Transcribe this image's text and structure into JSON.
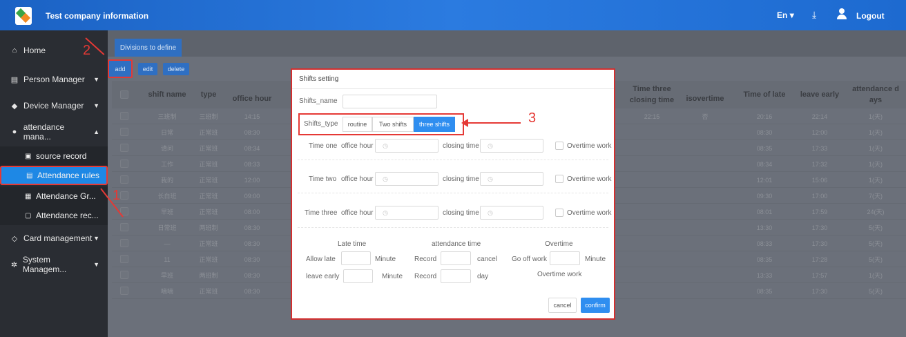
{
  "header": {
    "title": "Test company information",
    "language": "En",
    "logout": "Logout"
  },
  "sidebar": {
    "items": [
      {
        "label": "Home",
        "icon": "home-icon"
      },
      {
        "label": "Person Manager",
        "icon": "list-icon"
      },
      {
        "label": "Device Manager",
        "icon": "device-icon"
      },
      {
        "label": "attendance mana...",
        "icon": "clock-icon"
      },
      {
        "label": "Card management",
        "icon": "card-icon"
      },
      {
        "label": "System Managem...",
        "icon": "gear-icon"
      }
    ],
    "subitems": [
      {
        "label": "source record",
        "icon": "edit-icon"
      },
      {
        "label": "Attendance rules",
        "icon": "rules-icon"
      },
      {
        "label": "Attendance Gr...",
        "icon": "group-icon"
      },
      {
        "label": "Attendance rec...",
        "icon": "calendar-icon"
      }
    ]
  },
  "tabs": {
    "divisions": "Divisions to define"
  },
  "toolbar": {
    "add": "add",
    "edit": "edit",
    "delete": "delete"
  },
  "table": {
    "headers": {
      "shift_name": "shift name",
      "type": "type",
      "office_hour": "office hour",
      "time_three_closing": "Time three closing time",
      "isovertime": "isovertime",
      "time_of_late": "Time of late",
      "leave_early": "leave early",
      "attendance_days": "attendance d ays"
    },
    "rows": [
      {
        "name": "三班制",
        "type": "三班制",
        "hour": "14:15",
        "closing": "22:15",
        "overtime": "否",
        "late": "20:16",
        "early": "22:14",
        "days": "1(天)"
      },
      {
        "name": "日常",
        "type": "正常班",
        "hour": "08:30",
        "closing": "",
        "overtime": "",
        "late": "08:30",
        "early": "12:00",
        "days": "1(天)"
      },
      {
        "name": "请问",
        "type": "正常班",
        "hour": "08:34",
        "closing": "",
        "overtime": "",
        "late": "08:35",
        "early": "17:33",
        "days": "1(天)"
      },
      {
        "name": "工作",
        "type": "正常班",
        "hour": "08:33",
        "closing": "",
        "overtime": "",
        "late": "08:34",
        "early": "17:32",
        "days": "1(天)"
      },
      {
        "name": "我的",
        "type": "正常班",
        "hour": "12:00",
        "closing": "",
        "overtime": "",
        "late": "12:01",
        "early": "15:06",
        "days": "1(天)"
      },
      {
        "name": "长白班",
        "type": "正常班",
        "hour": "09:00",
        "closing": "",
        "overtime": "",
        "late": "09:30",
        "early": "17:00",
        "days": "7(天)"
      },
      {
        "name": "早班",
        "type": "正常班",
        "hour": "08:00",
        "closing": "",
        "overtime": "",
        "late": "08:01",
        "early": "17:59",
        "days": "24(天)"
      },
      {
        "name": "日常班",
        "type": "两班制",
        "hour": "08:30",
        "closing": "",
        "overtime": "",
        "late": "13:30",
        "early": "17:30",
        "days": "5(天)"
      },
      {
        "name": "—",
        "type": "正常班",
        "hour": "08:30",
        "closing": "",
        "overtime": "",
        "late": "08:33",
        "early": "17:30",
        "days": "5(天)"
      },
      {
        "name": "11",
        "type": "正常班",
        "hour": "08:30",
        "closing": "",
        "overtime": "",
        "late": "08:35",
        "early": "17:28",
        "days": "5(天)"
      },
      {
        "name": "早班",
        "type": "两班制",
        "hour": "08:30",
        "closing": "",
        "overtime": "",
        "late": "13:33",
        "early": "17:57",
        "days": "1(天)"
      },
      {
        "name": "嘀嘀",
        "type": "正常班",
        "hour": "08:30",
        "closing": "",
        "overtime": "",
        "late": "08:35",
        "early": "17:30",
        "days": "5(天)"
      }
    ]
  },
  "modal": {
    "title": "Shifts setting",
    "shifts_name_label": "Shifts_name",
    "shifts_type_label": "Shifts_type",
    "type_options": [
      "routine",
      "Two shifts",
      "three shifts"
    ],
    "selected_type": "three shifts",
    "time_rows": [
      {
        "label": "Time one",
        "office_hour": "office hour",
        "closing_time": "closing time",
        "overtime": "Overtime work"
      },
      {
        "label": "Time two",
        "office_hour": "office hour",
        "closing_time": "closing time",
        "overtime": "Overtime work"
      },
      {
        "label": "Time three",
        "office_hour": "office hour",
        "closing_time": "closing time",
        "overtime": "Overtime work"
      }
    ],
    "section_headers": {
      "late_time": "Late time",
      "attendance_time": "attendance time",
      "overtime": "Overtime"
    },
    "allow_late": "Allow late",
    "leave_early": "leave early",
    "minute": "Minute",
    "record": "Record",
    "cancel_word": "cancel",
    "day_word": "day",
    "go_off_work": "Go off work",
    "overtime_work": "Overtime work",
    "cancel_button": "cancel",
    "confirm_button": "confirm"
  },
  "annotations": [
    "1",
    "2",
    "3"
  ],
  "colors": {
    "header_blue": "#2b7be0",
    "highlight_red": "#e53935",
    "selected_blue": "#2f8ef0"
  }
}
